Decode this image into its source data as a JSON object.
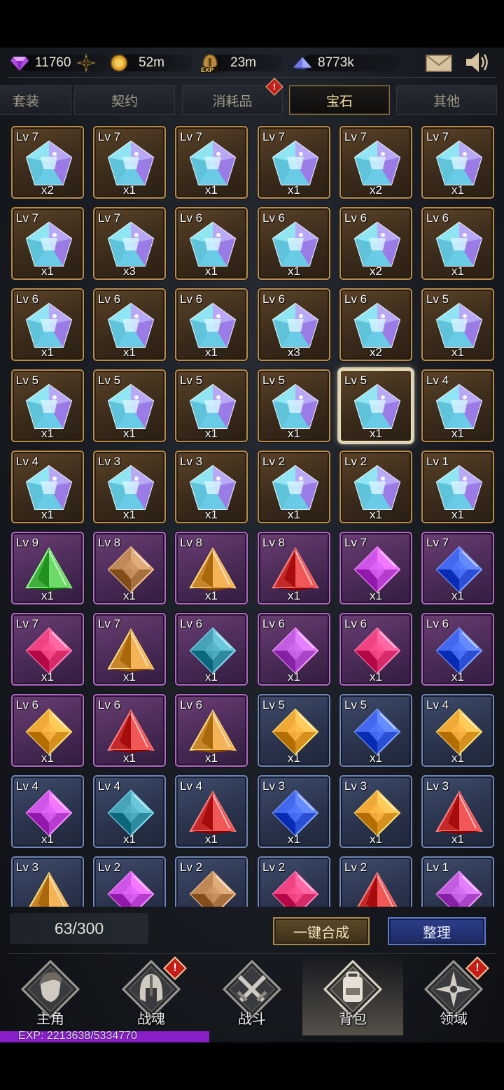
{
  "resources": {
    "gems": "11760",
    "gold": "52m",
    "exp": "23m",
    "crystal": "8773k",
    "exp_icon_text": "EXP"
  },
  "colors": {
    "accent_gold": "#b68c4f",
    "slot_purple": "#b068c2",
    "slot_blue": "#6f86b6",
    "exp_bar": "#8b1fc7",
    "sort_button": "#2c3e8a"
  },
  "tabs": [
    {
      "label": "套装",
      "active": false
    },
    {
      "label": "契约",
      "active": false
    },
    {
      "label": "消耗品",
      "active": false,
      "alert": "!"
    },
    {
      "label": "宝石",
      "active": true
    },
    {
      "label": "其他",
      "active": false
    }
  ],
  "items": [
    {
      "lv": "Lv 7",
      "count": "x2",
      "frame": "gold",
      "gem": "pentagon"
    },
    {
      "lv": "Lv 7",
      "count": "x1",
      "frame": "gold",
      "gem": "pentagon"
    },
    {
      "lv": "Lv 7",
      "count": "x1",
      "frame": "gold",
      "gem": "pentagon"
    },
    {
      "lv": "Lv 7",
      "count": "x1",
      "frame": "gold",
      "gem": "pentagon"
    },
    {
      "lv": "Lv 7",
      "count": "x2",
      "frame": "gold",
      "gem": "pentagon"
    },
    {
      "lv": "Lv 7",
      "count": "x1",
      "frame": "gold",
      "gem": "pentagon"
    },
    {
      "lv": "Lv 7",
      "count": "x1",
      "frame": "gold",
      "gem": "pentagon"
    },
    {
      "lv": "Lv 7",
      "count": "x3",
      "frame": "gold",
      "gem": "pentagon"
    },
    {
      "lv": "Lv 6",
      "count": "x1",
      "frame": "gold",
      "gem": "pentagon"
    },
    {
      "lv": "Lv 6",
      "count": "x1",
      "frame": "gold",
      "gem": "pentagon"
    },
    {
      "lv": "Lv 6",
      "count": "x2",
      "frame": "gold",
      "gem": "pentagon"
    },
    {
      "lv": "Lv 6",
      "count": "x1",
      "frame": "gold",
      "gem": "pentagon"
    },
    {
      "lv": "Lv 6",
      "count": "x1",
      "frame": "gold",
      "gem": "pentagon"
    },
    {
      "lv": "Lv 6",
      "count": "x1",
      "frame": "gold",
      "gem": "pentagon"
    },
    {
      "lv": "Lv 6",
      "count": "x1",
      "frame": "gold",
      "gem": "pentagon"
    },
    {
      "lv": "Lv 6",
      "count": "x3",
      "frame": "gold",
      "gem": "pentagon"
    },
    {
      "lv": "Lv 6",
      "count": "x2",
      "frame": "gold",
      "gem": "pentagon"
    },
    {
      "lv": "Lv 5",
      "count": "x1",
      "frame": "gold",
      "gem": "pentagon"
    },
    {
      "lv": "Lv 5",
      "count": "x1",
      "frame": "gold",
      "gem": "pentagon"
    },
    {
      "lv": "Lv 5",
      "count": "x1",
      "frame": "gold",
      "gem": "pentagon"
    },
    {
      "lv": "Lv 5",
      "count": "x1",
      "frame": "gold",
      "gem": "pentagon"
    },
    {
      "lv": "Lv 5",
      "count": "x1",
      "frame": "gold",
      "gem": "pentagon"
    },
    {
      "lv": "Lv 5",
      "count": "x1",
      "frame": "gold",
      "gem": "pentagon",
      "selected": true
    },
    {
      "lv": "Lv 4",
      "count": "x1",
      "frame": "gold",
      "gem": "pentagon"
    },
    {
      "lv": "Lv 4",
      "count": "x1",
      "frame": "gold",
      "gem": "pentagon"
    },
    {
      "lv": "Lv 3",
      "count": "x1",
      "frame": "gold",
      "gem": "pentagon"
    },
    {
      "lv": "Lv 3",
      "count": "x1",
      "frame": "gold",
      "gem": "pentagon"
    },
    {
      "lv": "Lv 2",
      "count": "x1",
      "frame": "gold",
      "gem": "pentagon"
    },
    {
      "lv": "Lv 2",
      "count": "x1",
      "frame": "gold",
      "gem": "pentagon"
    },
    {
      "lv": "Lv 1",
      "count": "x1",
      "frame": "gold",
      "gem": "pentagon"
    },
    {
      "lv": "Lv 9",
      "count": "x1",
      "frame": "purple",
      "gem": "triangle",
      "color": "#3fae3a"
    },
    {
      "lv": "Lv 8",
      "count": "x1",
      "frame": "purple",
      "gem": "rhombus",
      "color": "#a6703e"
    },
    {
      "lv": "Lv 8",
      "count": "x1",
      "frame": "purple",
      "gem": "triangle",
      "color": "#c8862a"
    },
    {
      "lv": "Lv 8",
      "count": "x1",
      "frame": "purple",
      "gem": "triangle",
      "color": "#c42a2a"
    },
    {
      "lv": "Lv 7",
      "count": "x1",
      "frame": "purple",
      "gem": "rhombus",
      "color": "#b63ccf"
    },
    {
      "lv": "Lv 7",
      "count": "x1",
      "frame": "purple",
      "gem": "rhombus",
      "color": "#2a4fd6"
    },
    {
      "lv": "Lv 7",
      "count": "x1",
      "frame": "purple",
      "gem": "rhombus",
      "color": "#d62b68"
    },
    {
      "lv": "Lv 7",
      "count": "x1",
      "frame": "purple",
      "gem": "triangle",
      "color": "#c8862a"
    },
    {
      "lv": "Lv 6",
      "count": "x1",
      "frame": "purple",
      "gem": "rhombus",
      "color": "#2e8a9e"
    },
    {
      "lv": "Lv 6",
      "count": "x1",
      "frame": "purple",
      "gem": "rhombus",
      "color": "#a943c7"
    },
    {
      "lv": "Lv 6",
      "count": "x1",
      "frame": "purple",
      "gem": "rhombus",
      "color": "#d62b68"
    },
    {
      "lv": "Lv 6",
      "count": "x1",
      "frame": "purple",
      "gem": "rhombus",
      "color": "#2a4fd6"
    },
    {
      "lv": "Lv 6",
      "count": "x1",
      "frame": "purple",
      "gem": "rhombus",
      "color": "#d6901e"
    },
    {
      "lv": "Lv 6",
      "count": "x1",
      "frame": "purple",
      "gem": "triangle",
      "color": "#c42a2a"
    },
    {
      "lv": "Lv 6",
      "count": "x1",
      "frame": "purple",
      "gem": "triangle",
      "color": "#c8862a"
    },
    {
      "lv": "Lv 5",
      "count": "x1",
      "frame": "blue",
      "gem": "rhombus",
      "color": "#d6901e"
    },
    {
      "lv": "Lv 5",
      "count": "x1",
      "frame": "blue",
      "gem": "rhombus",
      "color": "#2a4fd6"
    },
    {
      "lv": "Lv 4",
      "count": "x1",
      "frame": "blue",
      "gem": "rhombus",
      "color": "#d6901e"
    },
    {
      "lv": "Lv 4",
      "count": "x1",
      "frame": "blue",
      "gem": "rhombus",
      "color": "#b63ccf"
    },
    {
      "lv": "Lv 4",
      "count": "x1",
      "frame": "blue",
      "gem": "rhombus",
      "color": "#2e8a9e"
    },
    {
      "lv": "Lv 4",
      "count": "x1",
      "frame": "blue",
      "gem": "triangle",
      "color": "#c42a2a"
    },
    {
      "lv": "Lv 3",
      "count": "x1",
      "frame": "blue",
      "gem": "rhombus",
      "color": "#2a4fd6"
    },
    {
      "lv": "Lv 3",
      "count": "x1",
      "frame": "blue",
      "gem": "rhombus",
      "color": "#d6901e"
    },
    {
      "lv": "Lv 3",
      "count": "x1",
      "frame": "blue",
      "gem": "triangle",
      "color": "#c42a2a"
    },
    {
      "lv": "Lv 3",
      "count": "",
      "frame": "blue",
      "gem": "triangle",
      "color": "#c8862a"
    },
    {
      "lv": "Lv 2",
      "count": "",
      "frame": "blue",
      "gem": "rhombus",
      "color": "#b63ccf"
    },
    {
      "lv": "Lv 2",
      "count": "",
      "frame": "blue",
      "gem": "rhombus",
      "color": "#a6703e"
    },
    {
      "lv": "Lv 2",
      "count": "",
      "frame": "blue",
      "gem": "rhombus",
      "color": "#d62b68"
    },
    {
      "lv": "Lv 2",
      "count": "",
      "frame": "blue",
      "gem": "triangle",
      "color": "#c42a2a"
    },
    {
      "lv": "Lv 1",
      "count": "",
      "frame": "blue",
      "gem": "rhombus",
      "color": "#a943c7"
    }
  ],
  "capacity": "63/300",
  "buttons": {
    "merge": "一键合成",
    "sort": "整理"
  },
  "nav": [
    {
      "label": "主角",
      "icon": "hero-face-icon",
      "active": false,
      "alert": ""
    },
    {
      "label": "战魂",
      "icon": "helmet-icon",
      "active": false,
      "alert": "!"
    },
    {
      "label": "战斗",
      "icon": "crossed-swords-icon",
      "active": false,
      "alert": ""
    },
    {
      "label": "背包",
      "icon": "backpack-icon",
      "active": true,
      "alert": ""
    },
    {
      "label": "领域",
      "icon": "compass-star-icon",
      "active": false,
      "alert": "!"
    }
  ],
  "exp_bar": {
    "text": "EXP: 2213638/5334770",
    "fraction": 0.415
  }
}
